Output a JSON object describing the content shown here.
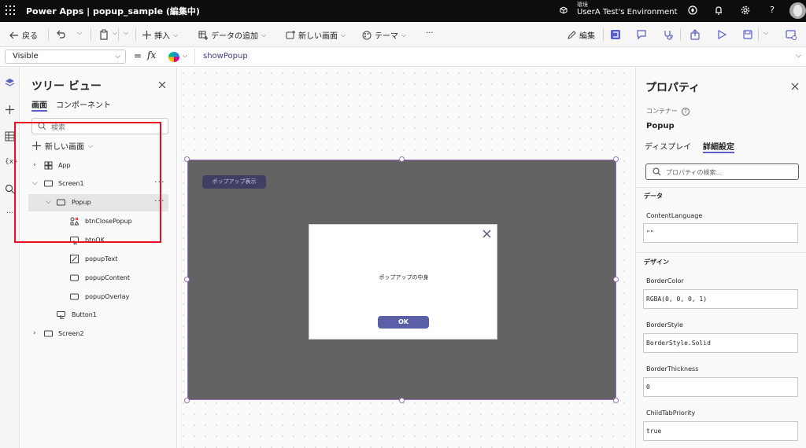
{
  "titlebar": {
    "app_title": "Power Apps | popup_sample (編集中)",
    "env_label": "環境",
    "env_name": "UserA Test's Environment",
    "icons": [
      "waffle-icon",
      "environment-icon",
      "copilot-icon",
      "notifications-icon",
      "settings-icon",
      "help-icon",
      "avatar"
    ]
  },
  "commandbar": {
    "back": "戻る",
    "insert": "挿入",
    "add_data": "データの追加",
    "new_screen": "新しい画面",
    "theme": "テーマ",
    "more": "···",
    "edit": "編集"
  },
  "formulabar": {
    "property": "Visible",
    "equals": "=",
    "fx": "fx",
    "formula": "showPopup"
  },
  "tree": {
    "title": "ツリー ビュー",
    "tabs": [
      "画面",
      "コンポーネント"
    ],
    "search_placeholder": "検索",
    "new_screen": "新しい画面",
    "nodes": [
      {
        "label": "App"
      },
      {
        "label": "Screen1"
      },
      {
        "label": "Popup"
      },
      {
        "label": "btnClosePopup"
      },
      {
        "label": "btnOK"
      },
      {
        "label": "popupText"
      },
      {
        "label": "popupContent"
      },
      {
        "label": "popupOverlay"
      },
      {
        "label": "Button1"
      },
      {
        "label": "Screen2"
      }
    ]
  },
  "canvas": {
    "show_popup_button": "ポップアップ表示",
    "popup_content_text": "ポップアップの中身",
    "ok_button": "OK",
    "screen_color": "#636363",
    "accent_color": "#5b5fa8"
  },
  "properties": {
    "title": "プロパティ",
    "control_type": "コンテナー",
    "control_name": "Popup",
    "tabs": [
      "ディスプレイ",
      "詳細設定"
    ],
    "search_placeholder": "プロパティの検索...",
    "sections": {
      "data": "データ",
      "design": "デザイン"
    },
    "fields": [
      {
        "label": "ContentLanguage",
        "value": "\"\""
      },
      {
        "label": "BorderColor",
        "value": "RGBA(0, 0, 0, 1)"
      },
      {
        "label": "BorderStyle",
        "value": "BorderStyle.Solid"
      },
      {
        "label": "BorderThickness",
        "value": "0"
      },
      {
        "label": "ChildTabPriority",
        "value": "true"
      }
    ]
  }
}
